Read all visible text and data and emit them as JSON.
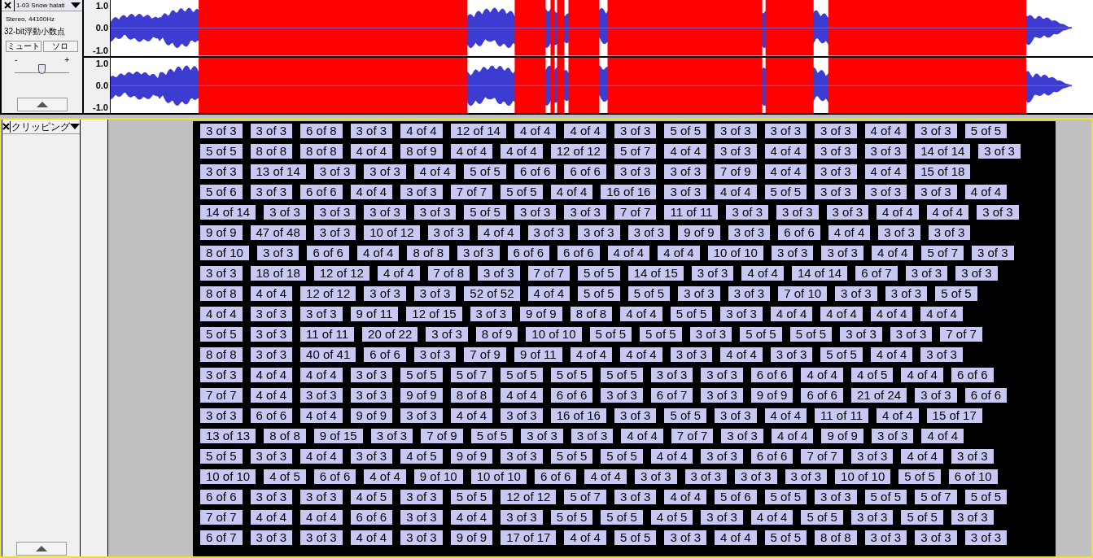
{
  "audio_track": {
    "name": "1-03 Snow halati",
    "format": "Stereo, 44100Hz",
    "sample_format": "32-bit浮動小数点",
    "mute": "ミュート",
    "solo": "ソロ",
    "gain_minus": "-",
    "gain_plus": "+",
    "gain": {
      "level": 0.5
    },
    "channels": [
      {
        "scale": [
          "1.0",
          "0.0",
          "-1.0"
        ]
      },
      {
        "scale": [
          "1.0",
          "0.0",
          "-1.0"
        ]
      }
    ]
  },
  "label_track": {
    "name": "クリッピング",
    "selected": true,
    "rows": [
      [
        "3 of 3",
        "3 of 3",
        "6 of 8",
        "3 of 3",
        "4 of 4",
        "12 of 14",
        "4 of 4",
        "4 of 4",
        "3 of 3",
        "5 of 5",
        "3 of 3",
        "3 of 3",
        "3 of 3",
        "4 of 4",
        "3 of 3",
        "5 of 5"
      ],
      [
        "5 of 5",
        "8 of 8",
        "8 of 8",
        "4 of 4",
        "8 of 9",
        "4 of 4",
        "4 of 4",
        "12 of 12",
        "5 of 7",
        "4 of 4",
        "3 of 3",
        "4 of 4",
        "3 of 3",
        "3 of 3",
        "14 of 14",
        "3 of 3"
      ],
      [
        "3 of 3",
        "13 of 14",
        "3 of 3",
        "3 of 3",
        "4 of 4",
        "5 of 5",
        "6 of 6",
        "6 of 6",
        "3 of 3",
        "3 of 3",
        "7 of 9",
        "4 of 4",
        "3 of 3",
        "4 of 4",
        "15 of 18"
      ],
      [
        "5 of 6",
        "3 of 3",
        "6 of 6",
        "4 of 4",
        "3 of 3",
        "7 of 7",
        "5 of 5",
        "4 of 4",
        "16 of 16",
        "3 of 3",
        "4 of 4",
        "5 of 5",
        "3 of 3",
        "3 of 3",
        "3 of 3",
        "4 of 4"
      ],
      [
        "14 of 14",
        "3 of 3",
        "3 of 3",
        "3 of 3",
        "3 of 3",
        "5 of 5",
        "3 of 3",
        "3 of 3",
        "7 of 7",
        "11 of 11",
        "3 of 3",
        "3 of 3",
        "3 of 3",
        "4 of 4",
        "4 of 4",
        "3 of 3"
      ],
      [
        "9 of 9",
        "47 of 48",
        "3 of 3",
        "10 of 12",
        "3 of 3",
        "4 of 4",
        "3 of 3",
        "3 of 3",
        "3 of 3",
        "9 of 9",
        "3 of 3",
        "6 of 6",
        "4 of 4",
        "3 of 3",
        "3 of 3"
      ],
      [
        "8 of 10",
        "3 of 3",
        "6 of 6",
        "4 of 4",
        "8 of 8",
        "3 of 3",
        "6 of 6",
        "6 of 6",
        "4 of 4",
        "4 of 4",
        "10 of 10",
        "3 of 3",
        "3 of 3",
        "4 of 4",
        "5 of 7",
        "3 of 3"
      ],
      [
        "3 of 3",
        "18 of 18",
        "12 of 12",
        "4 of 4",
        "7 of 8",
        "3 of 3",
        "7 of 7",
        "5 of 5",
        "14 of 15",
        "3 of 3",
        "4 of 4",
        "14 of 14",
        "6 of 7",
        "3 of 3",
        "3 of 3"
      ],
      [
        "8 of 8",
        "4 of 4",
        "12 of 12",
        "3 of 3",
        "3 of 3",
        "52 of 52",
        "4 of 4",
        "5 of 5",
        "5 of 5",
        "3 of 3",
        "3 of 3",
        "7 of 10",
        "3 of 3",
        "3 of 3",
        "5 of 5"
      ],
      [
        "4 of 4",
        "3 of 3",
        "3 of 3",
        "9 of 11",
        "12 of 15",
        "3 of 3",
        "9 of 9",
        "8 of 8",
        "4 of 4",
        "5 of 5",
        "3 of 3",
        "4 of 4",
        "4 of 4",
        "4 of 4",
        "4 of 4"
      ],
      [
        "5 of 5",
        "3 of 3",
        "11 of 11",
        "20 of 22",
        "3 of 3",
        "8 of 9",
        "10 of 10",
        "5 of 5",
        "5 of 5",
        "3 of 3",
        "5 of 5",
        "5 of 5",
        "3 of 3",
        "3 of 3",
        "7 of 7"
      ],
      [
        "8 of 8",
        "3 of 3",
        "40 of 41",
        "6 of 6",
        "3 of 3",
        "7 of 9",
        "9 of 11",
        "4 of 4",
        "4 of 4",
        "3 of 3",
        "4 of 4",
        "3 of 3",
        "5 of 5",
        "4 of 4",
        "3 of 3"
      ],
      [
        "3 of 3",
        "4 of 4",
        "4 of 4",
        "3 of 3",
        "5 of 5",
        "5 of 7",
        "5 of 5",
        "5 of 5",
        "5 of 5",
        "3 of 3",
        "3 of 3",
        "6 of 6",
        "4 of 4",
        "4 of 5",
        "4 of 4",
        "6 of 6"
      ],
      [
        "7 of 7",
        "4 of 4",
        "3 of 3",
        "3 of 3",
        "9 of 9",
        "8 of 8",
        "4 of 4",
        "6 of 6",
        "3 of 3",
        "6 of 7",
        "3 of 3",
        "9 of 9",
        "6 of 6",
        "21 of 24",
        "3 of 3",
        "6 of 6"
      ],
      [
        "3 of 3",
        "6 of 6",
        "4 of 4",
        "9 of 9",
        "3 of 3",
        "4 of 4",
        "3 of 3",
        "16 of 16",
        "3 of 3",
        "5 of 5",
        "3 of 3",
        "4 of 4",
        "11 of 11",
        "4 of 4",
        "15 of 17"
      ],
      [
        "13 of 13",
        "8 of 8",
        "9 of 15",
        "3 of 3",
        "7 of 9",
        "5 of 5",
        "3 of 3",
        "3 of 3",
        "4 of 4",
        "7 of 7",
        "3 of 3",
        "4 of 4",
        "9 of 9",
        "3 of 3",
        "4 of 4"
      ],
      [
        "5 of 5",
        "3 of 3",
        "4 of 4",
        "3 of 3",
        "4 of 5",
        "9 of 9",
        "3 of 3",
        "5 of 5",
        "5 of 5",
        "4 of 4",
        "3 of 3",
        "6 of 6",
        "7 of 7",
        "3 of 3",
        "4 of 4",
        "3 of 3"
      ],
      [
        "10 of 10",
        "4 of 5",
        "6 of 6",
        "4 of 4",
        "9 of 10",
        "10 of 10",
        "6 of 6",
        "4 of 4",
        "3 of 3",
        "3 of 3",
        "3 of 3",
        "3 of 3",
        "10 of 10",
        "5 of 5",
        "6 of 10"
      ],
      [
        "6 of 6",
        "3 of 3",
        "3 of 3",
        "4 of 5",
        "3 of 3",
        "5 of 5",
        "12 of 12",
        "5 of 7",
        "3 of 3",
        "4 of 4",
        "5 of 6",
        "5 of 5",
        "3 of 3",
        "5 of 5",
        "5 of 7",
        "5 of 5"
      ],
      [
        "7 of 7",
        "4 of 4",
        "4 of 4",
        "6 of 6",
        "3 of 3",
        "4 of 4",
        "3 of 3",
        "5 of 5",
        "5 of 5",
        "4 of 5",
        "3 of 3",
        "4 of 4",
        "5 of 5",
        "3 of 3",
        "5 of 5",
        "3 of 3"
      ],
      [
        "6 of 7",
        "3 of 3",
        "3 of 3",
        "4 of 4",
        "3 of 3",
        "9 of 9",
        "17 of 17",
        "4 of 4",
        "5 of 5",
        "3 of 3",
        "4 of 4",
        "5 of 5",
        "8 of 8",
        "3 of 3",
        "3 of 3",
        "3 of 3"
      ]
    ]
  }
}
